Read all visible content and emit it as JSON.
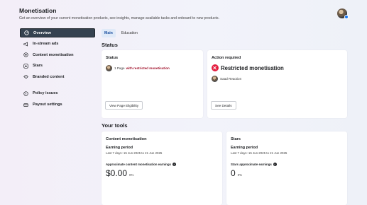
{
  "header": {
    "title": "Monetisation",
    "subtitle": "Get an overview of your current monetisation products, see insights, manage available tasks and onboard to new products."
  },
  "sidebar": {
    "items": [
      {
        "label": "Overview",
        "icon": "gauge-icon"
      },
      {
        "label": "In-stream ads",
        "icon": "megaphone-icon"
      },
      {
        "label": "Content monetisation",
        "icon": "coin-icon"
      },
      {
        "label": "Stars",
        "icon": "star-icon"
      },
      {
        "label": "Branded content",
        "icon": "handshake-icon"
      },
      {
        "label": "Policy issues",
        "icon": "alert-circle-icon"
      },
      {
        "label": "Payout settings",
        "icon": "wallet-icon"
      }
    ]
  },
  "tabs": [
    "Main",
    "Education"
  ],
  "status_section": {
    "title": "Status",
    "status_card": {
      "title": "Status",
      "pages_text": "1 Page",
      "restricted_text": "with restricted monetisation",
      "button": "View Page Eligibility"
    },
    "action_card": {
      "title": "Action required",
      "headline": "Restricted monetisation",
      "page_name": "Saad Reaction",
      "button": "See Details"
    }
  },
  "tools_section": {
    "title": "Your tools",
    "content_card": {
      "title": "Content monetisation",
      "earning_label": "Earning period",
      "range": "Last 7 days: 15 Jun 2025 to 21 Jun 2025",
      "approx_label": "Approximate content monetisation earnings",
      "value": "$0.00",
      "pct": "0%"
    },
    "stars_card": {
      "title": "Stars",
      "earning_label": "Earning period",
      "range": "Last 7 days: 15 Jun 2025 to 21 Jun 2025",
      "approx_label": "Stars approximate earnings",
      "value": "0",
      "pct": "0%"
    }
  },
  "colors": {
    "active_nav_bg": "#354250",
    "restricted_red": "#a1122b",
    "error_red": "#e41e3f",
    "tab_active_blue": "#1b4fa0"
  }
}
